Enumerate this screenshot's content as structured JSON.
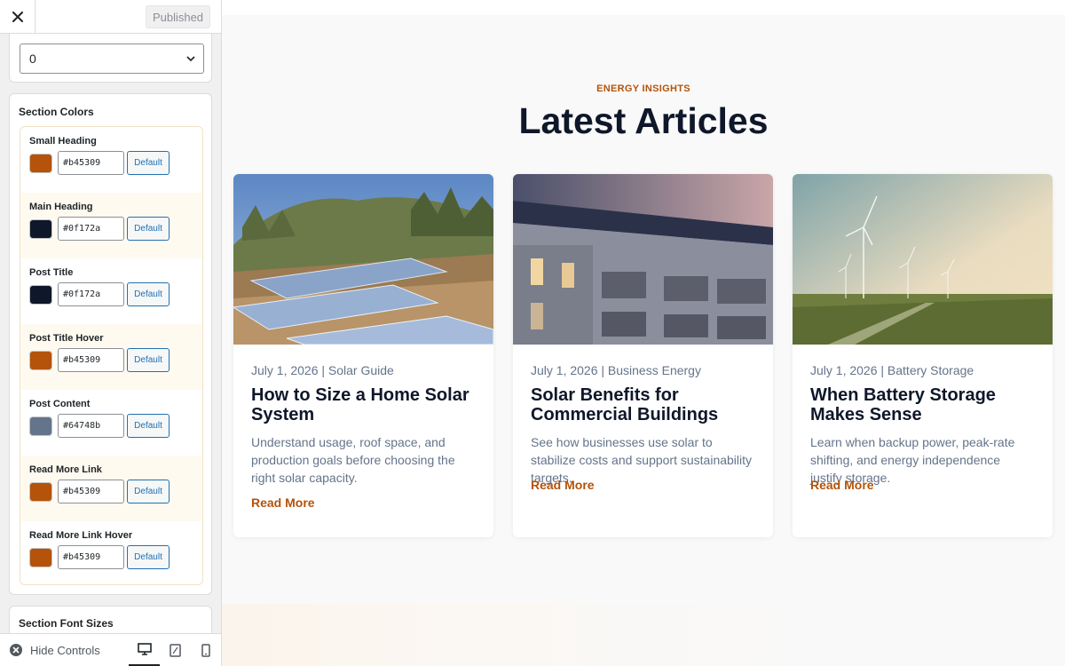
{
  "topbar": {
    "publish_label": "Published"
  },
  "partial_panel": {
    "select_value": "0"
  },
  "colors_panel": {
    "title": "Section Colors",
    "default_label": "Default",
    "rows": [
      {
        "label": "Small Heading",
        "hex": "#b45309"
      },
      {
        "label": "Main Heading",
        "hex": "#0f172a"
      },
      {
        "label": "Post Title",
        "hex": "#0f172a"
      },
      {
        "label": "Post Title Hover",
        "hex": "#b45309"
      },
      {
        "label": "Post Content",
        "hex": "#64748b"
      },
      {
        "label": "Read More Link",
        "hex": "#b45309"
      },
      {
        "label": "Read More Link Hover",
        "hex": "#b45309"
      }
    ]
  },
  "fonts_panel": {
    "title": "Section Font Sizes"
  },
  "bottombar": {
    "hide_label": "Hide Controls",
    "devices": [
      "desktop",
      "tablet",
      "mobile"
    ],
    "active_device": "desktop"
  },
  "preview": {
    "kicker": "ENERGY INSIGHTS",
    "heading": "Latest Articles",
    "read_more": "Read More",
    "cards": [
      {
        "meta": "July 1, 2026 | Solar Guide",
        "title": "How to Size a Home Solar System",
        "excerpt": "Understand usage, roof space, and production goals before choosing the right solar capacity."
      },
      {
        "meta": "July 1, 2026 | Business Energy",
        "title": "Solar Benefits for Commercial Buildings",
        "excerpt": "See how businesses use solar to stabilize costs and support sustainability targets."
      },
      {
        "meta": "July 1, 2026 | Battery Storage",
        "title": "When Battery Storage Makes Sense",
        "excerpt": "Learn when backup power, peak-rate shifting, and energy independence justify storage."
      }
    ]
  }
}
